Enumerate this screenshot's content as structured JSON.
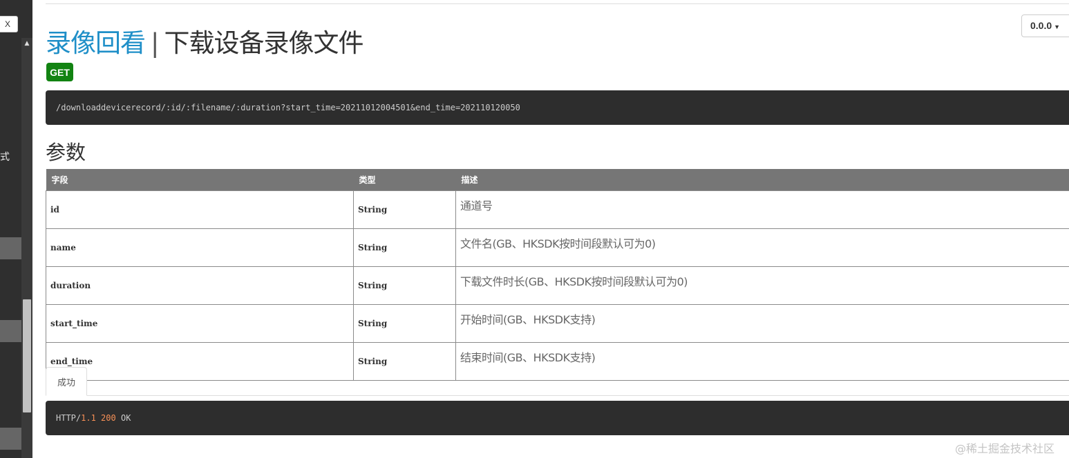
{
  "sidebar": {
    "close_label": "X",
    "fragment_text": "式"
  },
  "header": {
    "group_title": "录像回看",
    "separator": "|",
    "api_title": "下载设备录像文件",
    "version": "0.0.0",
    "method": "GET"
  },
  "endpoint": {
    "url": "/downloaddevicerecord/:id/:filename/:duration?start_time=20211012004501&end_time=202110120050"
  },
  "params": {
    "heading": "参数",
    "columns": [
      "字段",
      "类型",
      "描述"
    ],
    "rows": [
      {
        "field": "id",
        "type": "String",
        "desc": "通道号"
      },
      {
        "field": "name",
        "type": "String",
        "desc": "文件名(GB、HKSDK按时间段默认可为0)"
      },
      {
        "field": "duration",
        "type": "String",
        "desc": "下载文件时长(GB、HKSDK按时间段默认可为0)"
      },
      {
        "field": "start_time",
        "type": "String",
        "desc": "开始时间(GB、HKSDK支持)"
      },
      {
        "field": "end_time",
        "type": "String",
        "desc": "结束时间(GB、HKSDK支持)"
      }
    ]
  },
  "response": {
    "tab_label": "成功",
    "protocol": "HTTP/",
    "version": "1.1",
    "status_code": "200",
    "status_text": "OK"
  },
  "watermark": "@稀土掘金技术社区",
  "colors": {
    "group_title": "#1f8fc8",
    "get_badge": "#128312",
    "code_bg": "#2d2d2d",
    "table_header": "#767676",
    "number_highlight": "#f99157"
  }
}
